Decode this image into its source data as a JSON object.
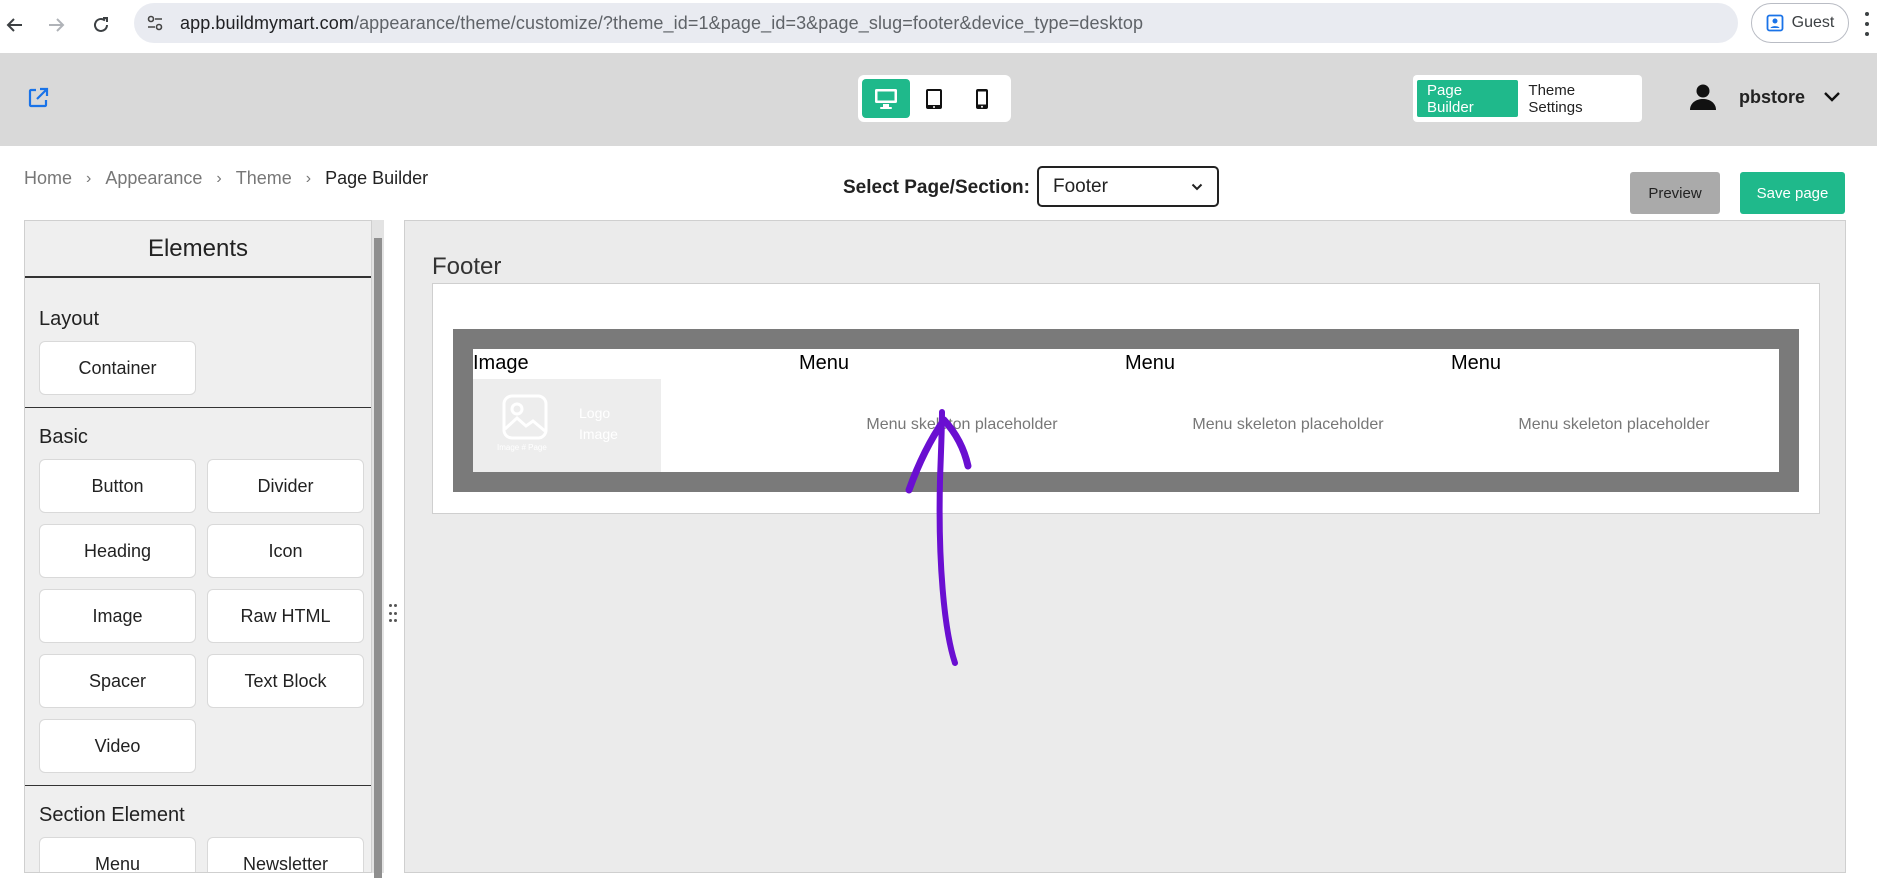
{
  "browser": {
    "url_host": "app.buildmymart.com",
    "url_path": "/appearance/theme/customize/?theme_id=1&page_id=3&page_slug=footer&device_type=desktop",
    "profile_label": "Guest"
  },
  "header": {
    "devices": [
      "desktop",
      "tablet",
      "mobile"
    ],
    "active_device": "desktop",
    "modes": {
      "page_builder": "Page Builder",
      "theme_settings": "Theme Settings"
    },
    "active_mode": "page_builder",
    "username": "pbstore"
  },
  "breadcrumb": {
    "items": [
      "Home",
      "Appearance",
      "Theme"
    ],
    "current": "Page Builder"
  },
  "toolbar": {
    "select_label": "Select Page/Section:",
    "selected_page": "Footer",
    "preview_label": "Preview",
    "save_label": "Save page"
  },
  "sidebar": {
    "title": "Elements",
    "groups": [
      {
        "title": "Layout",
        "items": [
          "Container"
        ]
      },
      {
        "title": "Basic",
        "items": [
          "Button",
          "Divider",
          "Heading",
          "Icon",
          "Image",
          "Raw HTML",
          "Spacer",
          "Text Block",
          "Video"
        ]
      },
      {
        "title": "Section Element",
        "items": [
          "Menu",
          "Newsletter"
        ]
      }
    ]
  },
  "canvas": {
    "section_title": "Footer",
    "columns": [
      {
        "title": "Image",
        "placeholder_main": "Logo Image",
        "placeholder_sub": "Image # Page"
      },
      {
        "title": "Menu",
        "placeholder": "Menu skeleton placeholder"
      },
      {
        "title": "Menu",
        "placeholder": "Menu skeleton placeholder"
      },
      {
        "title": "Menu",
        "placeholder": "Menu skeleton placeholder"
      }
    ]
  },
  "colors": {
    "accent": "#1fb98b",
    "header_bg": "#d9d9d9",
    "annotation": "#6a0fd1",
    "footer_frame": "#7a7a7a"
  }
}
